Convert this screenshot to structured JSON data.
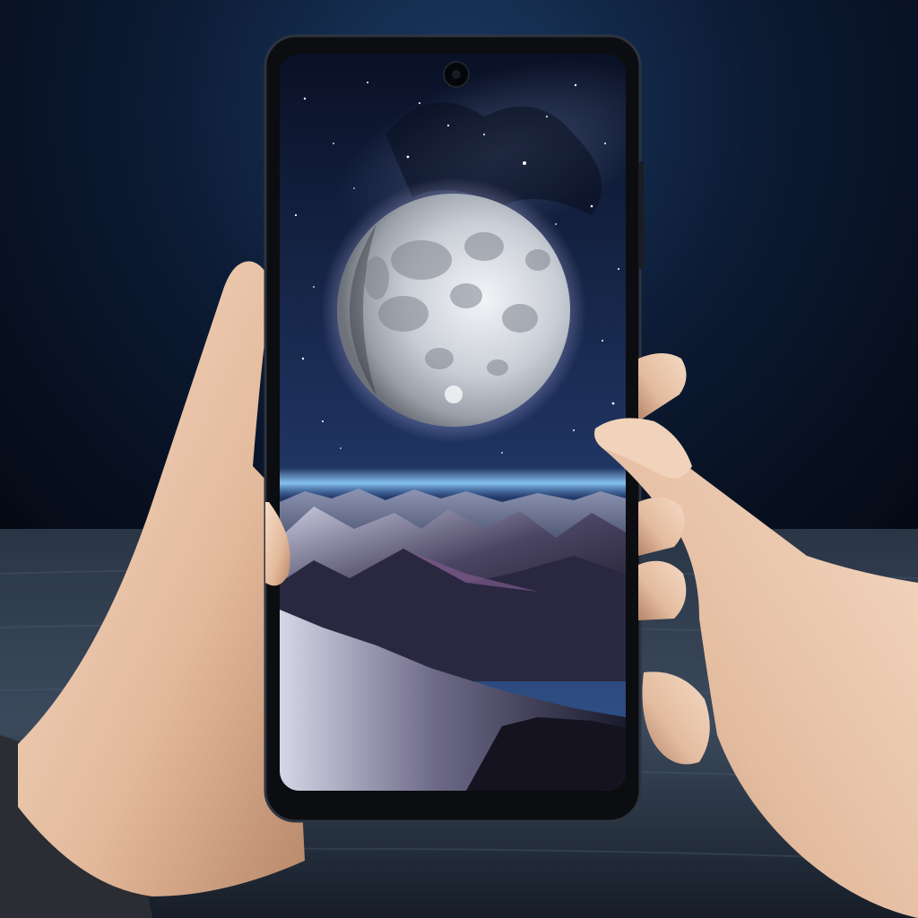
{
  "scene": {
    "colors": {
      "backdrop_top": "#10243f",
      "backdrop_mid": "#0a1426",
      "backdrop_dark": "#03060d",
      "table_top": "#3b4a5c",
      "table_bottom": "#1a2230",
      "phone_frame": "#0b0d10",
      "sky_top": "#0b1630",
      "sky_bottom": "#2c4a7e",
      "moon_light": "#e9edf2",
      "moon_dark": "#8a9099",
      "moon_glow": "#cfc6ff",
      "horizon_glow": "#6fb6ff",
      "mountain_light": "#c9c9dc",
      "mountain_dark": "#1a1a2c",
      "mountain_accent": "#7d5a8c",
      "skin_light": "#f3d8c2",
      "skin_mid": "#e2b99c",
      "skin_shadow": "#b98a6d",
      "sleeve": "#2a2d33"
    }
  }
}
